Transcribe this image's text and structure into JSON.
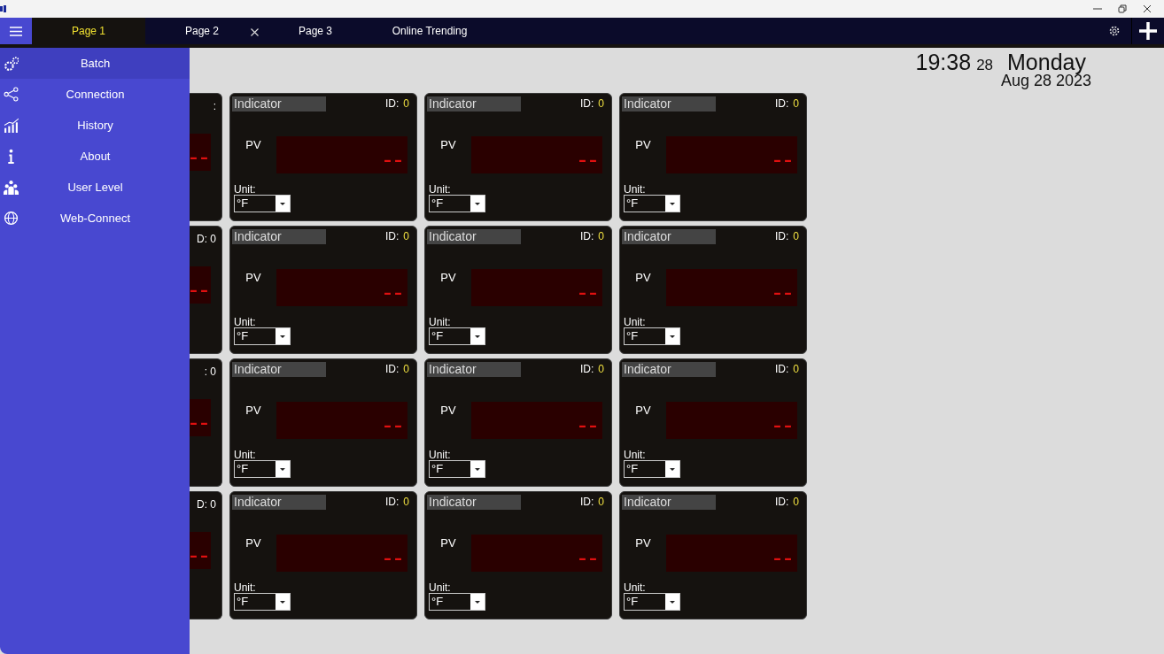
{
  "tabs": [
    {
      "label": "Page 1",
      "selected": true,
      "closable": false
    },
    {
      "label": "Page 2",
      "selected": false,
      "closable": true
    },
    {
      "label": "Page 3",
      "selected": false,
      "closable": false
    },
    {
      "label": "Online Trending",
      "selected": false,
      "closable": false
    }
  ],
  "menu": [
    {
      "label": "Batch",
      "selected": true
    },
    {
      "label": "Connection",
      "selected": false
    },
    {
      "label": "History",
      "selected": false
    },
    {
      "label": "About",
      "selected": false
    },
    {
      "label": "User Level",
      "selected": false
    },
    {
      "label": "Web-Connect",
      "selected": false
    }
  ],
  "clock": {
    "time": "19:38",
    "seconds": "28",
    "weekday": "Monday",
    "date": "Aug 28 2023"
  },
  "cards": [
    {
      "kind": "clipped",
      "id_text": ":",
      "reading": "--"
    },
    {
      "kind": "full",
      "title": "Indicator",
      "id_label": "ID:",
      "id_value": "0",
      "pv_label": "PV",
      "reading": "--",
      "unit_label": "Unit:",
      "unit": "°F"
    },
    {
      "kind": "full",
      "title": "Indicator",
      "id_label": "ID:",
      "id_value": "0",
      "pv_label": "PV",
      "reading": "--",
      "unit_label": "Unit:",
      "unit": "°F"
    },
    {
      "kind": "full",
      "title": "Indicator",
      "id_label": "ID:",
      "id_value": "0",
      "pv_label": "PV",
      "reading": "--",
      "unit_label": "Unit:",
      "unit": "°F"
    },
    {
      "kind": "clipped",
      "id_text": "D: 0",
      "reading": "--"
    },
    {
      "kind": "full",
      "title": "Indicator",
      "id_label": "ID:",
      "id_value": "0",
      "pv_label": "PV",
      "reading": "--",
      "unit_label": "Unit:",
      "unit": "°F"
    },
    {
      "kind": "full",
      "title": "Indicator",
      "id_label": "ID:",
      "id_value": "0",
      "pv_label": "PV",
      "reading": "--",
      "unit_label": "Unit:",
      "unit": "°F"
    },
    {
      "kind": "full",
      "title": "Indicator",
      "id_label": "ID:",
      "id_value": "0",
      "pv_label": "PV",
      "reading": "--",
      "unit_label": "Unit:",
      "unit": "°F"
    },
    {
      "kind": "clipped",
      "id_text": ": 0",
      "reading": "--"
    },
    {
      "kind": "full",
      "title": "Indicator",
      "id_label": "ID:",
      "id_value": "0",
      "pv_label": "PV",
      "reading": "--",
      "unit_label": "Unit:",
      "unit": "°F"
    },
    {
      "kind": "full",
      "title": "Indicator",
      "id_label": "ID:",
      "id_value": "0",
      "pv_label": "PV",
      "reading": "--",
      "unit_label": "Unit:",
      "unit": "°F"
    },
    {
      "kind": "full",
      "title": "Indicator",
      "id_label": "ID:",
      "id_value": "0",
      "pv_label": "PV",
      "reading": "--",
      "unit_label": "Unit:",
      "unit": "°F"
    },
    {
      "kind": "clipped",
      "id_text": "D: 0",
      "reading": "--"
    },
    {
      "kind": "full",
      "title": "Indicator",
      "id_label": "ID:",
      "id_value": "0",
      "pv_label": "PV",
      "reading": "--",
      "unit_label": "Unit:",
      "unit": "°F"
    },
    {
      "kind": "full",
      "title": "Indicator",
      "id_label": "ID:",
      "id_value": "0",
      "pv_label": "PV",
      "reading": "--",
      "unit_label": "Unit:",
      "unit": "°F"
    },
    {
      "kind": "full",
      "title": "Indicator",
      "id_label": "ID:",
      "id_value": "0",
      "pv_label": "PV",
      "reading": "--",
      "unit_label": "Unit:",
      "unit": "°F"
    }
  ]
}
